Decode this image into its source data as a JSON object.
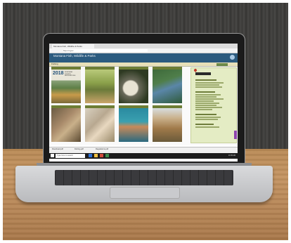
{
  "browser": {
    "tab_label": "Montana Fish, Wildlife & Parks",
    "url": "fwp.mt.gov"
  },
  "site": {
    "title": "Montana Fish, Wildlife & Parks",
    "nav_label": "Fishing"
  },
  "thumbnails": [
    {
      "caption": "",
      "overlay": "2018",
      "overlay_sub": "MONTANA FISHING REGULATIONS"
    },
    {
      "caption": ""
    },
    {
      "caption": ""
    },
    {
      "caption": ""
    },
    {
      "caption": ""
    },
    {
      "caption": ""
    },
    {
      "caption": ""
    },
    {
      "caption": ""
    }
  ],
  "taskbar": {
    "downloads": [
      "Download.pdf",
      "Fishing.pdf",
      "Regulations.pdf"
    ],
    "search_placeholder": "Type here to search",
    "clock": "10:45 AM"
  },
  "colors": {
    "header": "#2c5b7f",
    "caption_bar": "#6d7d34",
    "sidebar": "#e4ecc4"
  }
}
